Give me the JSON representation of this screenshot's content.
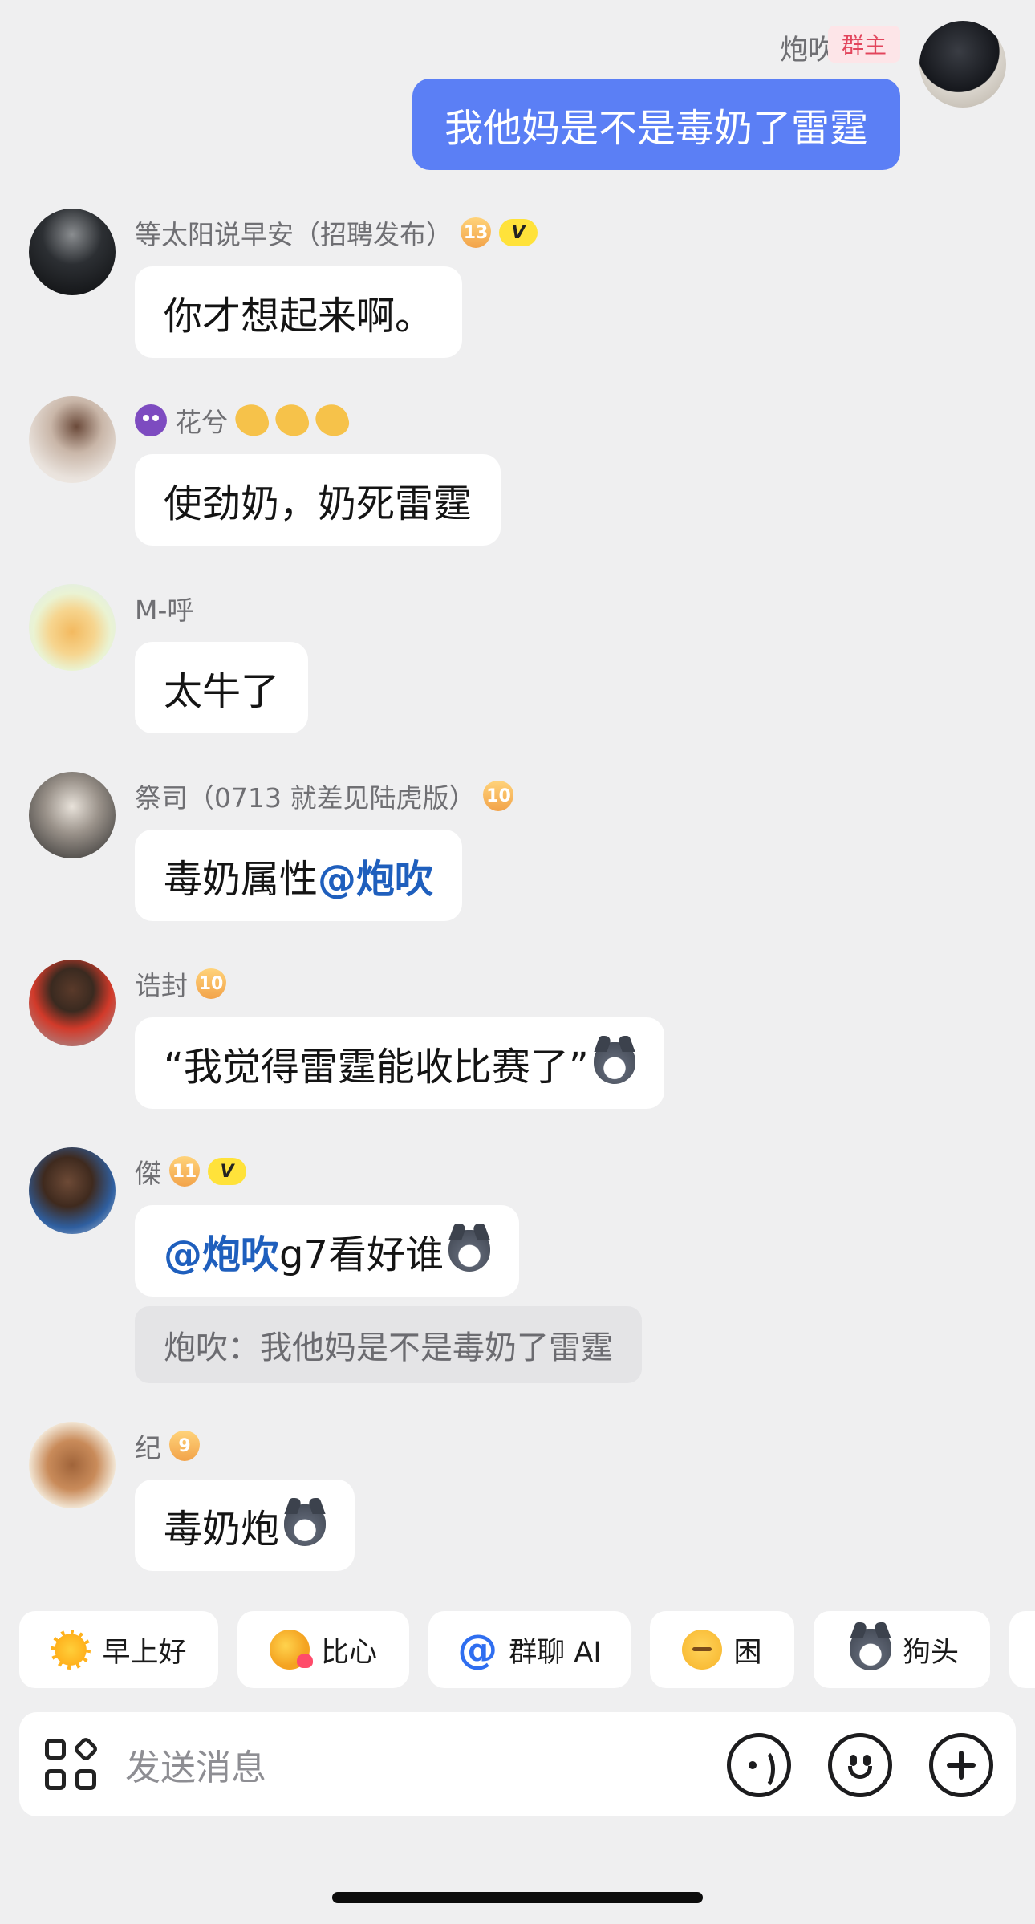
{
  "me": {
    "name": "炮吹",
    "role_tag": "群主",
    "message": "我他妈是不是毒奶了雷霆"
  },
  "messages": [
    {
      "sender": "等太阳说早安（招聘发布）",
      "level": "13",
      "vip": "V",
      "text": "你才想起来啊。"
    },
    {
      "sender": "花兮",
      "text": "使劲奶，奶死雷霆"
    },
    {
      "sender": "M-呼",
      "text": "太牛了"
    },
    {
      "sender": "祭司（0713 就差见陆虎版）",
      "level": "10",
      "text_prefix": "毒奶属性 ",
      "mention": "@炮吹"
    },
    {
      "sender": "诰封",
      "level": "10",
      "text": "“我觉得雷霆能收比赛了”"
    },
    {
      "sender": "傑",
      "level": "11",
      "vip": "V",
      "mention": "@炮吹",
      "text_suffix": " g7看好谁",
      "quote": "炮吹：我他妈是不是毒奶了雷霆"
    },
    {
      "sender": "纪",
      "level": "9",
      "text": "毒奶炮"
    }
  ],
  "quick_replies": [
    {
      "icon": "sun-face-icon",
      "label": "早上好"
    },
    {
      "icon": "heart-hand-icon",
      "label": "比心"
    },
    {
      "icon": "at-icon",
      "label": "群聊 AI"
    },
    {
      "icon": "sleepy-face-icon",
      "label": "困"
    },
    {
      "icon": "dog-head-icon",
      "label": "狗头"
    }
  ],
  "input": {
    "placeholder": "发送消息"
  },
  "colors": {
    "my_bubble": "#5b7ff5",
    "mention": "#1f5fbd",
    "owner_tag_text": "#e2455c",
    "background": "#efeff0"
  }
}
